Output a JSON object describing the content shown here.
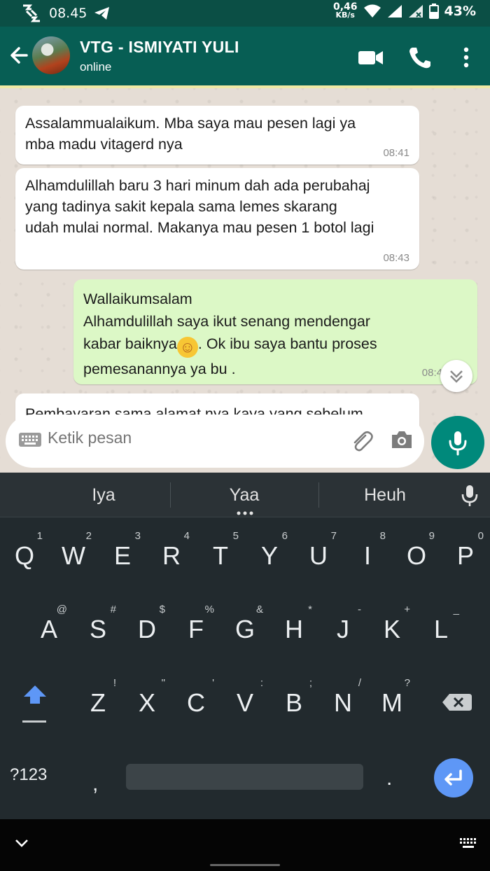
{
  "status_bar": {
    "time": "08.45",
    "net_speed_value": "0,46",
    "net_speed_unit": "KB/s",
    "battery": "43%"
  },
  "header": {
    "contact_name": "VTG - ISMIYATI YULI",
    "contact_status": "online",
    "icons": [
      "back-arrow-icon",
      "video-call-icon",
      "voice-call-icon",
      "more-options-icon"
    ]
  },
  "messages": [
    {
      "direction": "incoming",
      "lines": [
        "Assalammualaikum. Mba saya mau pesen lagi ya",
        "mba madu vitagerd nya"
      ],
      "time": "08:41"
    },
    {
      "direction": "incoming",
      "lines": [
        "Alhamdulillah baru 3 hari minum dah ada perubahaj",
        "yang tadinya sakit kepala sama lemes skarang",
        "udah mulai normal. Makanya mau pesen 1 botol lagi"
      ],
      "time": "08:43"
    },
    {
      "direction": "outgoing",
      "lines": [
        "Wallaikumsalam",
        "Alhamdulillah saya ikut senang mendengar",
        "kabar baiknya",
        "☺",
        ". Ok ibu saya bantu proses",
        "pemesanannya ya bu ."
      ],
      "time": "08:4"
    },
    {
      "direction": "incoming",
      "lines": [
        "Pembayaran sama alamat nya kaya yang sebelum"
      ]
    }
  ],
  "composer": {
    "placeholder": "Ketik pesan"
  },
  "keyboard": {
    "suggestions": [
      "Iya",
      "Yaa",
      "Heuh"
    ],
    "row1": [
      {
        "key": "Q",
        "hint": "1"
      },
      {
        "key": "W",
        "hint": "2"
      },
      {
        "key": "E",
        "hint": "3"
      },
      {
        "key": "R",
        "hint": "4"
      },
      {
        "key": "T",
        "hint": "5"
      },
      {
        "key": "Y",
        "hint": "6"
      },
      {
        "key": "U",
        "hint": "7"
      },
      {
        "key": "I",
        "hint": "8"
      },
      {
        "key": "O",
        "hint": "9"
      },
      {
        "key": "P",
        "hint": "0"
      }
    ],
    "row2": [
      {
        "key": "A",
        "hint": "@"
      },
      {
        "key": "S",
        "hint": "#"
      },
      {
        "key": "D",
        "hint": "$"
      },
      {
        "key": "F",
        "hint": "%"
      },
      {
        "key": "G",
        "hint": "&"
      },
      {
        "key": "H",
        "hint": "*"
      },
      {
        "key": "J",
        "hint": "-"
      },
      {
        "key": "K",
        "hint": "+"
      },
      {
        "key": "L",
        "hint": "_"
      }
    ],
    "row3": [
      {
        "key": "Z",
        "hint": "!"
      },
      {
        "key": "X",
        "hint": "\""
      },
      {
        "key": "C",
        "hint": "'"
      },
      {
        "key": "V",
        "hint": ":"
      },
      {
        "key": "B",
        "hint": ";"
      },
      {
        "key": "N",
        "hint": "/"
      },
      {
        "key": "M",
        "hint": "?"
      }
    ],
    "symbols_key": "?123",
    "comma": ",",
    "period": ".",
    "accent_color": "#5e97f6"
  },
  "colors": {
    "header": "#075e54",
    "outgoing_bubble": "#dcf8c6",
    "mic_button": "#00897b"
  }
}
